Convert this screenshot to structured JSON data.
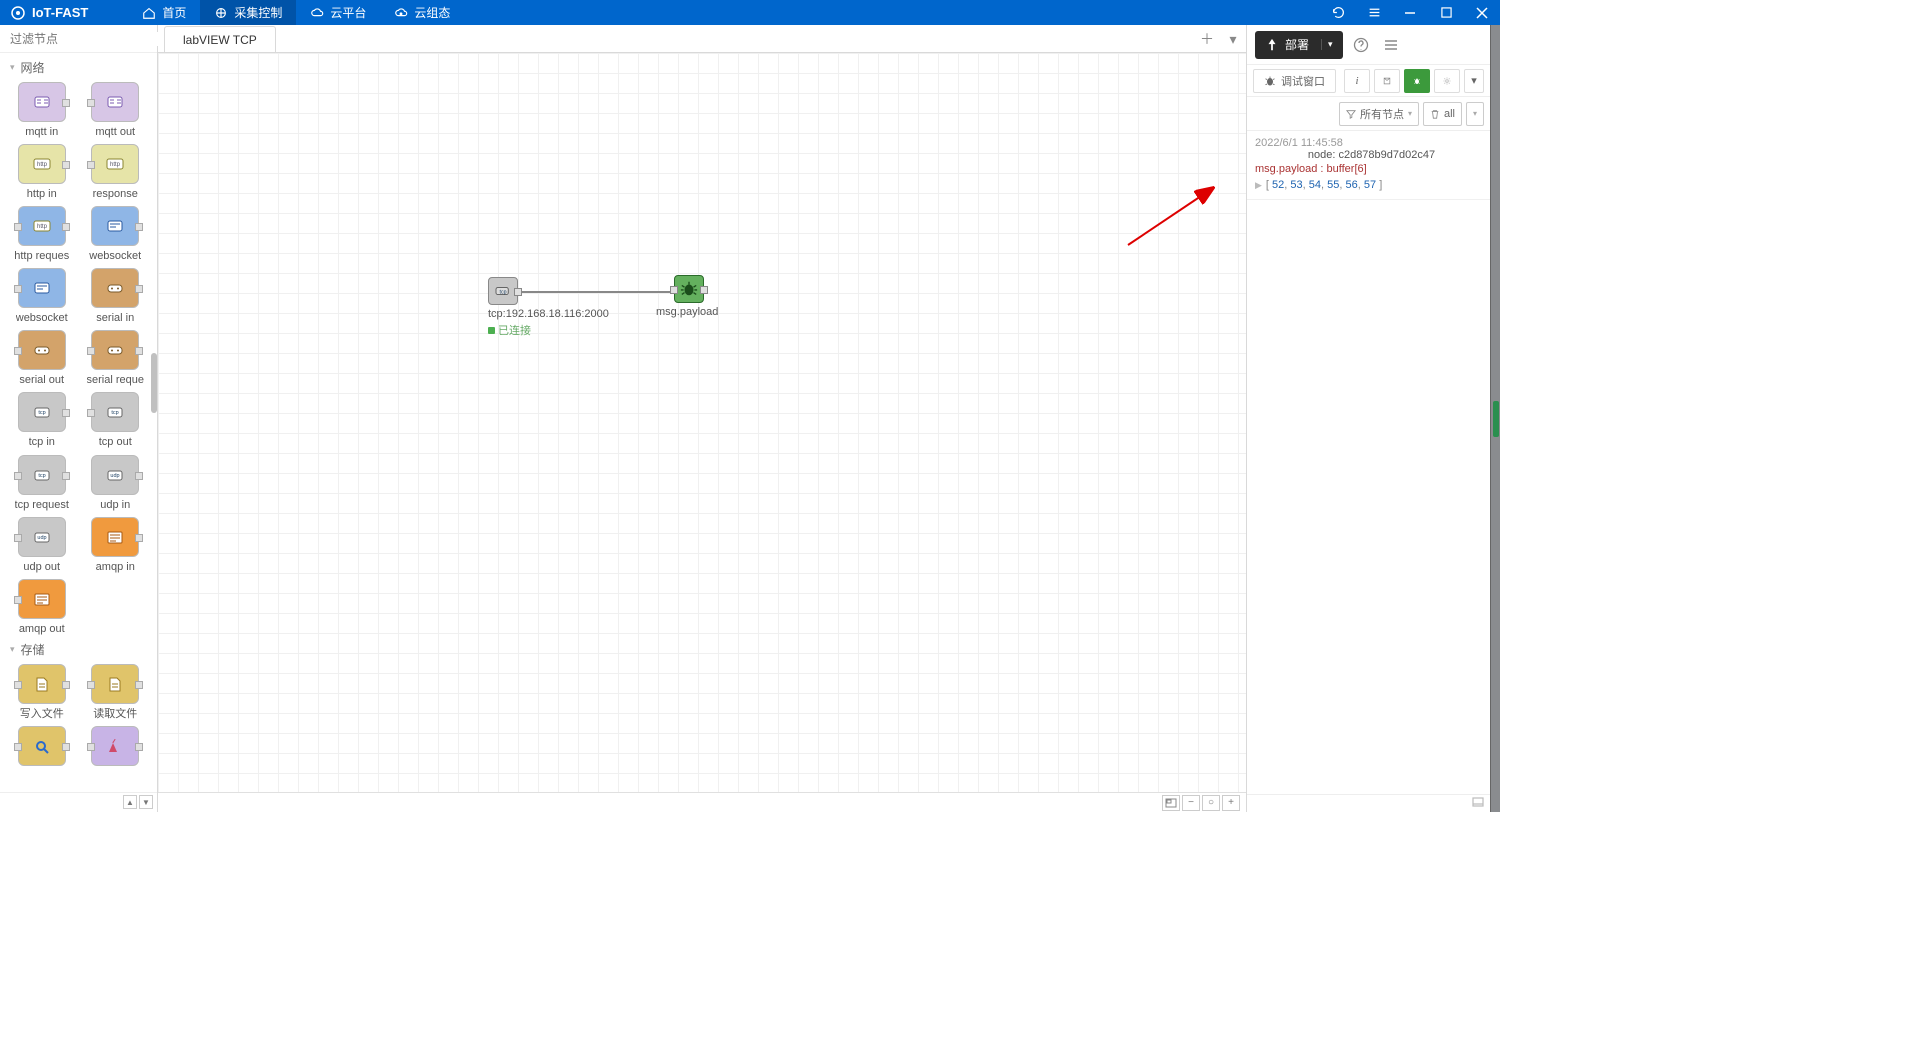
{
  "brand": "IoT-FAST",
  "topnav": [
    {
      "id": "home",
      "label": "首页"
    },
    {
      "id": "collect",
      "label": "采集控制",
      "active": true
    },
    {
      "id": "cloud",
      "label": "云平台"
    },
    {
      "id": "cloudstate",
      "label": "云组态"
    }
  ],
  "palette": {
    "search_placeholder": "过滤节点",
    "cats": [
      {
        "name": "网络",
        "nodes": [
          {
            "id": "mqtt-in",
            "label": "mqtt in",
            "theme": "c-mqttin",
            "ports": "R"
          },
          {
            "id": "mqtt-out",
            "label": "mqtt out",
            "theme": "c-mqttout",
            "ports": "L"
          },
          {
            "id": "http-in",
            "label": "http in",
            "theme": "c-http",
            "ports": "R"
          },
          {
            "id": "http-response",
            "label": "response",
            "theme": "c-http",
            "ports": "L"
          },
          {
            "id": "http-request",
            "label": "http reques",
            "theme": "c-ws1",
            "ports": "LR"
          },
          {
            "id": "websocket-in",
            "label": "websocket",
            "theme": "c-ws2",
            "ports": "R"
          },
          {
            "id": "websocket-out",
            "label": "websocket",
            "theme": "c-ws2",
            "ports": "L"
          },
          {
            "id": "serial-in",
            "label": "serial in",
            "theme": "c-serial",
            "ports": "R"
          },
          {
            "id": "serial-out",
            "label": "serial out",
            "theme": "c-serial",
            "ports": "L"
          },
          {
            "id": "serial-request",
            "label": "serial reque",
            "theme": "c-serial",
            "ports": "LR"
          },
          {
            "id": "tcp-in",
            "label": "tcp in",
            "theme": "c-tcp",
            "ports": "R"
          },
          {
            "id": "tcp-out",
            "label": "tcp out",
            "theme": "c-tcp",
            "ports": "L"
          },
          {
            "id": "tcp-request",
            "label": "tcp request",
            "theme": "c-tcpreq",
            "ports": "LR"
          },
          {
            "id": "udp-in",
            "label": "udp in",
            "theme": "c-udp",
            "ports": "R"
          },
          {
            "id": "udp-out",
            "label": "udp out",
            "theme": "c-udp",
            "ports": "L"
          },
          {
            "id": "amqp-in",
            "label": "amqp in",
            "theme": "c-amqpin",
            "ports": "R"
          },
          {
            "id": "amqp-out",
            "label": "amqp out",
            "theme": "c-amqpout",
            "ports": "L"
          }
        ]
      },
      {
        "name": "存储",
        "nodes": [
          {
            "id": "file-write",
            "label": "写入文件",
            "theme": "c-file",
            "ports": "LR"
          },
          {
            "id": "file-read",
            "label": "读取文件",
            "theme": "c-file",
            "ports": "LR"
          },
          {
            "id": "search",
            "label": "",
            "theme": "c-search",
            "ports": "LR"
          },
          {
            "id": "volcano",
            "label": "",
            "theme": "c-volcano",
            "ports": "LR"
          }
        ]
      }
    ]
  },
  "tabs": [
    {
      "id": "t1",
      "label": "labVIEW TCP",
      "active": true
    }
  ],
  "flow": {
    "node_tcp": {
      "label": "tcp:192.168.18.116:2000",
      "status": "已连接"
    },
    "node_debug": {
      "label": "msg.payload"
    }
  },
  "deploy_label": "部署",
  "debug_panel": {
    "title": "调试窗口",
    "filter_label": "所有节点",
    "all_label": "all",
    "entry": {
      "ts": "2022/6/1 11:45:58",
      "node": "node: c2d878b9d7d02c47",
      "prop": "msg.payload : buffer[6]",
      "values": [
        52,
        53,
        54,
        55,
        56,
        57
      ]
    }
  }
}
